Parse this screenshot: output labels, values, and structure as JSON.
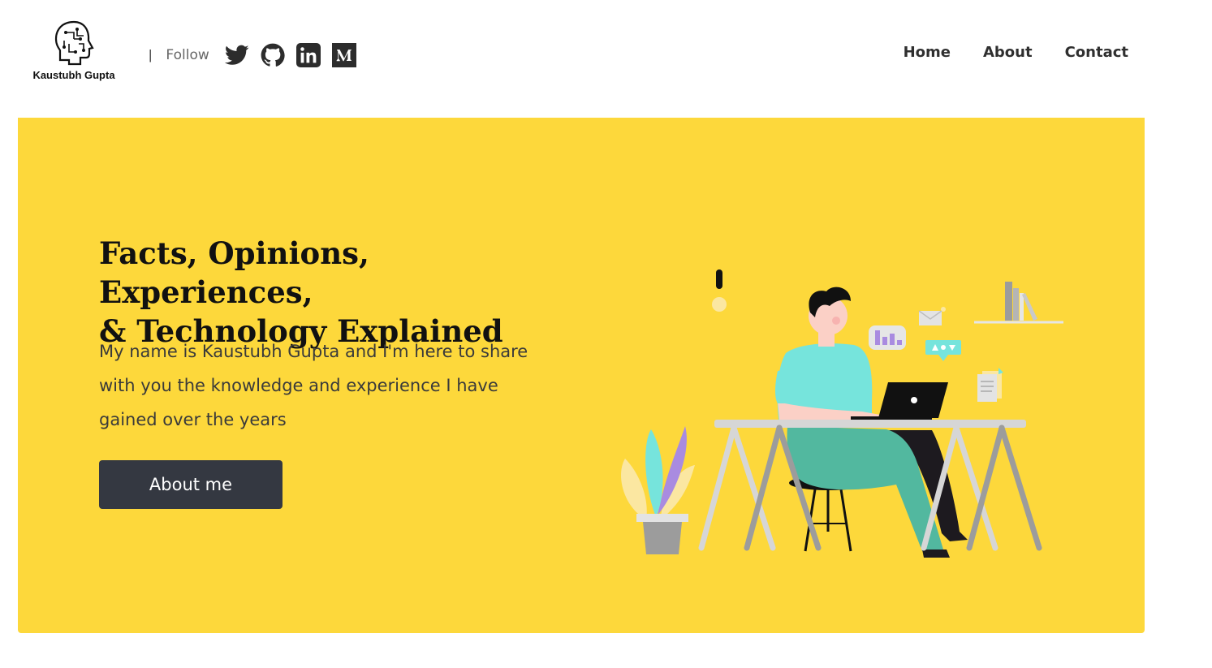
{
  "header": {
    "logo_text": "Kaustubh Gupta",
    "follow_separator": "|",
    "follow_label": "Follow",
    "social": [
      {
        "icon": "twitter-icon"
      },
      {
        "icon": "github-icon"
      },
      {
        "icon": "linkedin-icon"
      },
      {
        "icon": "medium-icon"
      }
    ],
    "nav": [
      "Home",
      "About",
      "Contact"
    ]
  },
  "hero": {
    "title": "Facts, Opinions, Experiences,\n& Technology Explained",
    "description": "My name is Kaustubh Gupta and I'm here to share with you the knowledge and experience I have gained over the years",
    "button_label": "About me"
  },
  "colors": {
    "hero_background": "#fdd83b",
    "button_background": "#343841",
    "icon_color": "#2c2c2c"
  }
}
